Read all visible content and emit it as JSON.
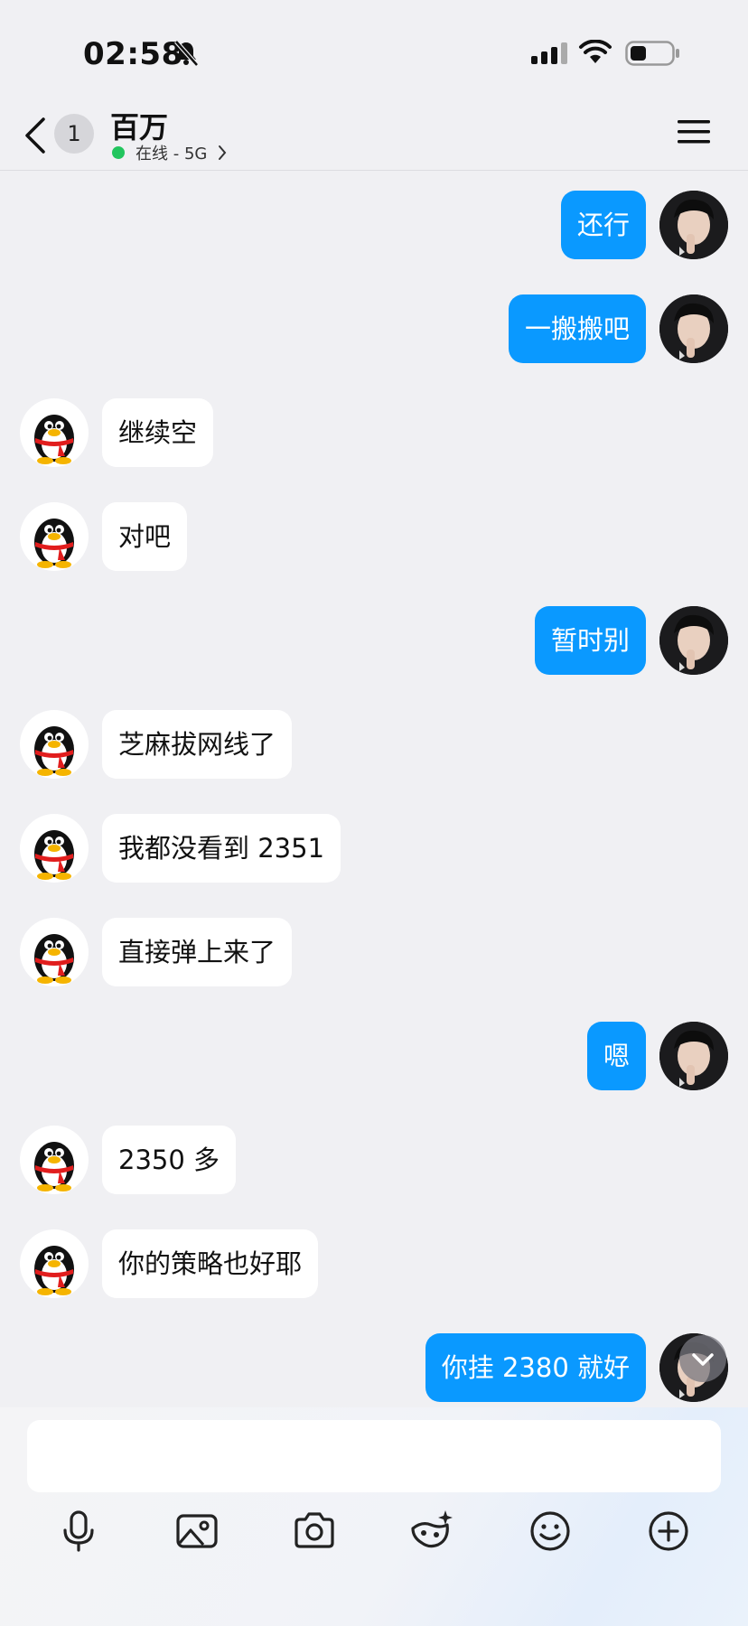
{
  "status_bar": {
    "time": "02:58",
    "icons": [
      "bell-muted-icon",
      "signal-icon",
      "wifi-icon",
      "battery-icon"
    ]
  },
  "header": {
    "back_icon": "chevron-left-icon",
    "unread_count": "1",
    "title": "百万",
    "status": "在线 - 5G",
    "status_color": "#22c55e",
    "menu_icon": "hamburger-menu-icon"
  },
  "colors": {
    "outgoing_bubble": "#0a99ff",
    "incoming_bubble": "#ffffff",
    "background": "#f0f0f3"
  },
  "messages": [
    {
      "side": "right",
      "text": "还行"
    },
    {
      "side": "right",
      "text": "一搬搬吧"
    },
    {
      "side": "left",
      "text": "继续空"
    },
    {
      "side": "left",
      "text": "对吧"
    },
    {
      "side": "right",
      "text": "暂时别"
    },
    {
      "side": "left",
      "text": "芝麻拔网线了"
    },
    {
      "side": "left",
      "text": "我都没看到 2351"
    },
    {
      "side": "left",
      "text": "直接弹上来了"
    },
    {
      "side": "right",
      "text": "嗯"
    },
    {
      "side": "left",
      "text": "2350 多"
    },
    {
      "side": "left",
      "text": "你的策略也好耶"
    },
    {
      "side": "right",
      "text": "你挂 2380 就好"
    }
  ],
  "input": {
    "value": "",
    "toolbar_icons": [
      "microphone-icon",
      "image-icon",
      "camera-icon",
      "mask-sparkle-icon",
      "emoji-icon",
      "plus-icon"
    ]
  }
}
